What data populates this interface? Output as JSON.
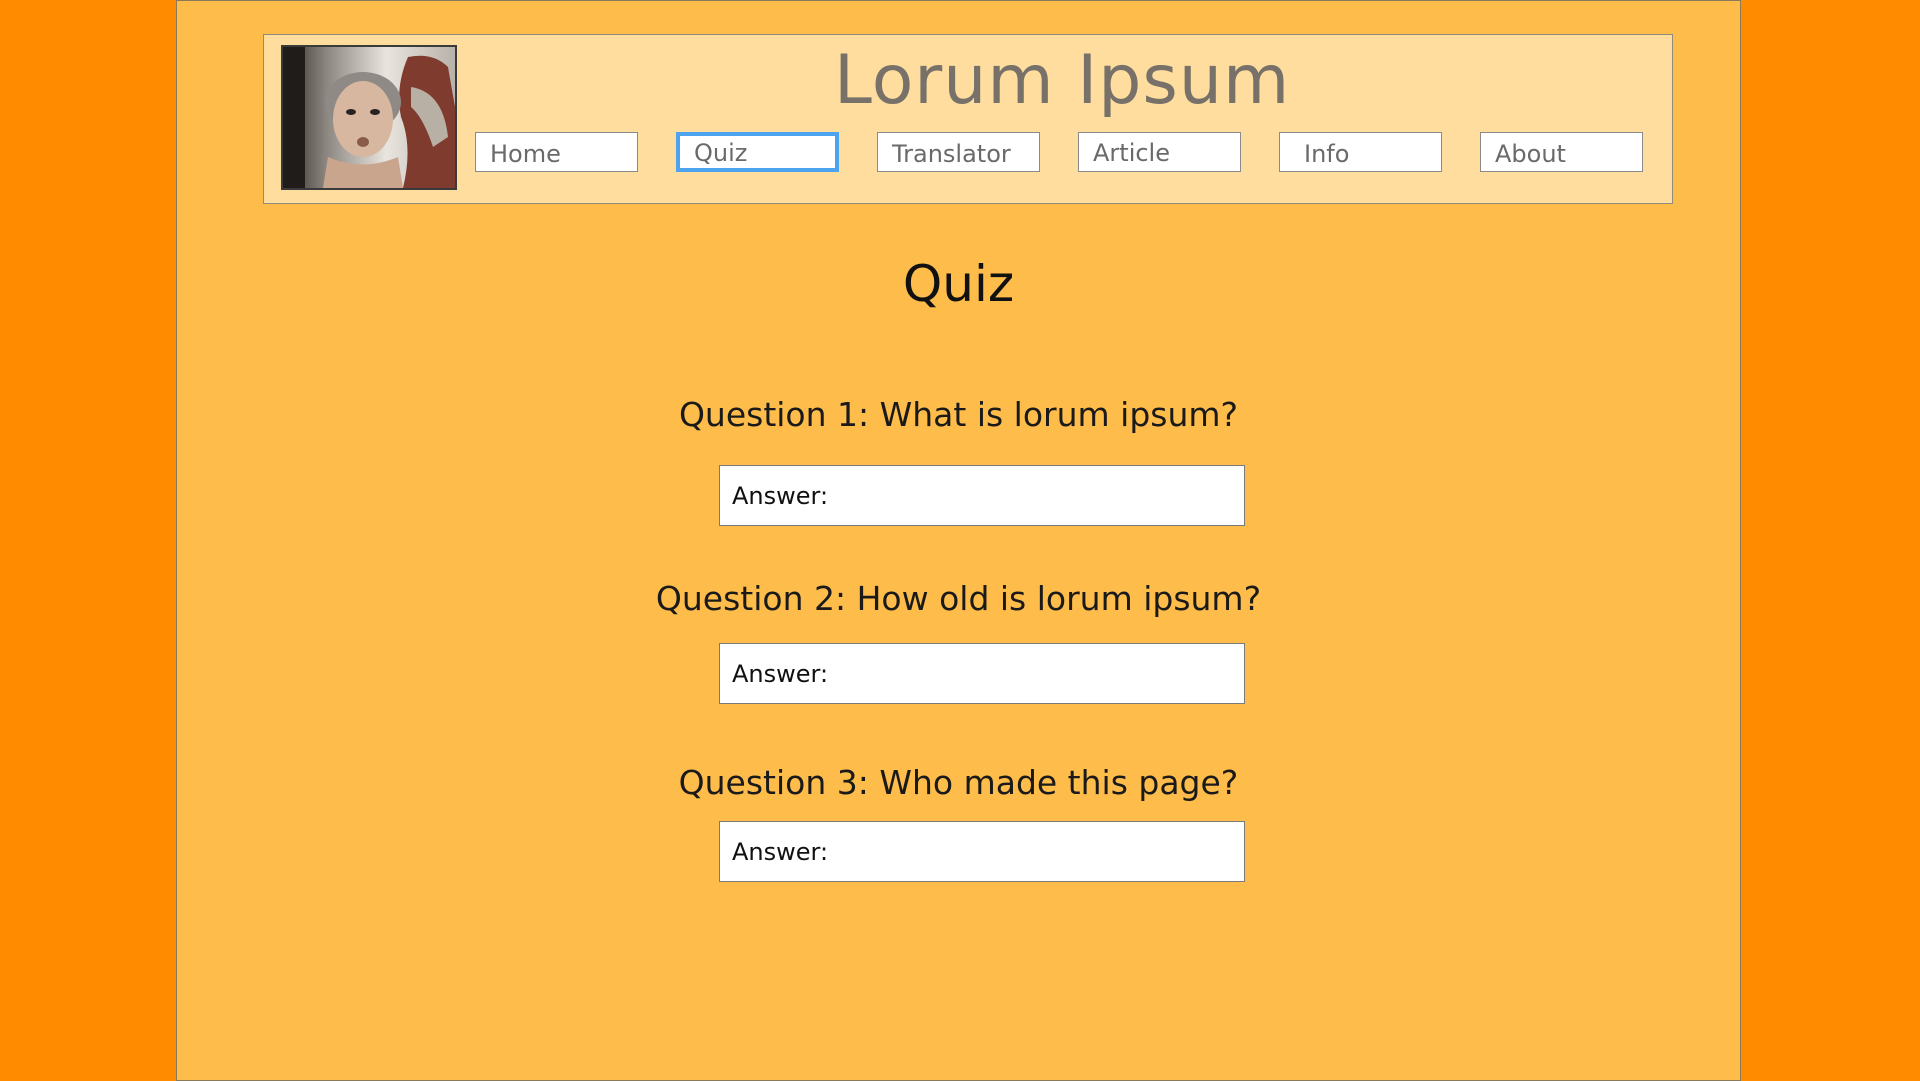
{
  "header": {
    "site_title": "Lorum Ipsum",
    "logo_alt": "portrait-photo",
    "nav": [
      {
        "label": "Home",
        "active": false
      },
      {
        "label": "Quiz",
        "active": true
      },
      {
        "label": "Translator",
        "active": false
      },
      {
        "label": "Article",
        "active": false
      },
      {
        "label": "Info",
        "active": false
      },
      {
        "label": "About",
        "active": false
      }
    ]
  },
  "main": {
    "title": "Quiz",
    "questions": [
      {
        "text": "Question 1: What is lorum ipsum?",
        "answer_placeholder": "Answer:",
        "answer_value": ""
      },
      {
        "text": "Question 2: How old is lorum ipsum?",
        "answer_placeholder": "Answer:",
        "answer_value": ""
      },
      {
        "text": "Question 3: Who made this page?",
        "answer_placeholder": "Answer:",
        "answer_value": ""
      }
    ]
  },
  "colors": {
    "outer_background": "#FF8C00",
    "page_background": "#FEBC4A",
    "header_background": "#FEDD9E",
    "active_border": "#4DA3EE"
  }
}
